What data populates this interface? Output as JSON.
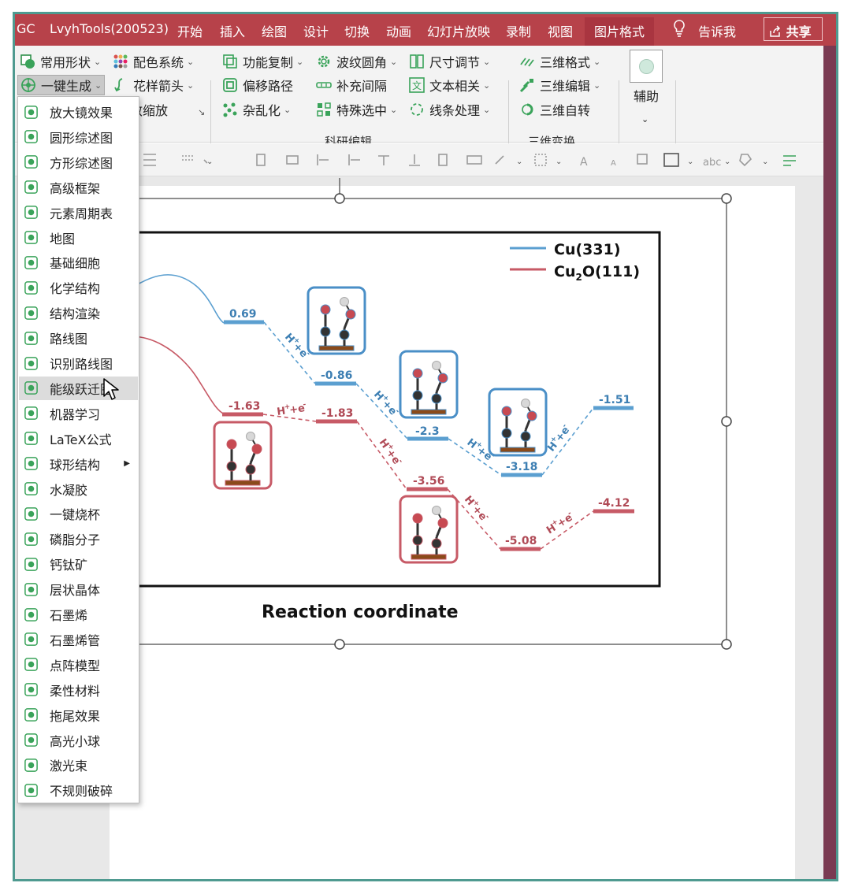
{
  "tabs": [
    "GC",
    "LvyhTools(200523)",
    "开始",
    "插入",
    "绘图",
    "设计",
    "切换",
    "动画",
    "幻灯片放映",
    "录制",
    "视图",
    "图片格式",
    "告诉我",
    "共享"
  ],
  "ribbon": {
    "buttons": [
      "常用形状",
      "配色系统",
      "一键生成",
      "花样箭头",
      "无敌缩放",
      "功能复制",
      "波纹圆角",
      "尺寸调节",
      "偏移路径",
      "补充间隔",
      "文本相关",
      "杂乱化",
      "特殊选中",
      "线条处理",
      "三维格式",
      "三维编辑",
      "三维自转",
      "辅助"
    ],
    "groups": [
      "科研编辑",
      "三维变换"
    ]
  },
  "menu": {
    "items": [
      "放大镜效果",
      "圆形综述图",
      "方形综述图",
      "高级框架",
      "元素周期表",
      "地图",
      "基础细胞",
      "化学结构",
      "结构渲染",
      "路线图",
      "识别路线图",
      "能级跃迁图",
      "机器学习",
      "LaTeX公式",
      "球形结构",
      "水凝胶",
      "一键烧杯",
      "磷脂分子",
      "钙钛矿",
      "层状晶体",
      "石墨烯",
      "石墨烯管",
      "点阵模型",
      "柔性材料",
      "拖尾效果",
      "高光小球",
      "激光束",
      "不规则破碎"
    ],
    "hovered": "能级跃迁图",
    "has_submenu": "球形结构"
  },
  "chart": {
    "legend": [
      "Cu(331)",
      "Cu",
      "2",
      "O(111)"
    ],
    "blue_labels": [
      "0.69",
      "-0.86",
      "-2.3",
      "-3.18",
      "-1.51"
    ],
    "red_labels": [
      "-1.63",
      "-1.83",
      "-3.56",
      "-5.08",
      "-4.12"
    ],
    "step_labels": [
      "H",
      "+",
      "+e",
      "-"
    ],
    "xlabel": "Reaction coordinate",
    "colors": {
      "blue": "#5b9fd0",
      "red": "#c75a66",
      "brown": "#8a4a1a"
    }
  }
}
